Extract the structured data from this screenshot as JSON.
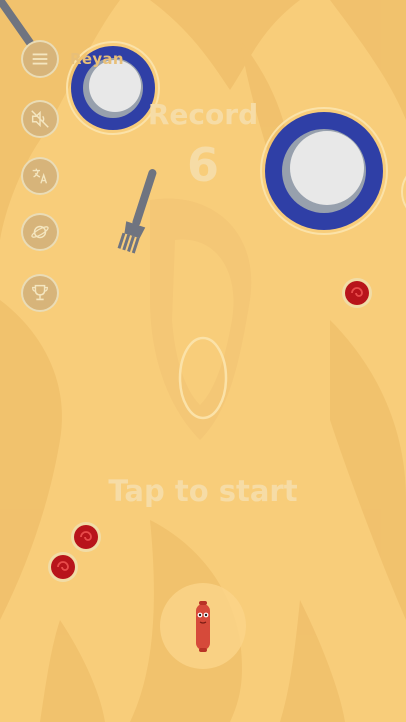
{
  "user": {
    "name": "Reyan"
  },
  "record": {
    "label": "Record",
    "value": "6"
  },
  "prompt": {
    "tap_to_start": "Tap to start"
  },
  "side_buttons": [
    {
      "id": "menu",
      "icon": "hamburger-icon"
    },
    {
      "id": "sound",
      "icon": "sound-muted-icon"
    },
    {
      "id": "language",
      "icon": "translate-icon"
    },
    {
      "id": "worlds",
      "icon": "planet-icon"
    },
    {
      "id": "leaderboard",
      "icon": "trophy-icon"
    }
  ],
  "colors": {
    "background": "#f8cd7a",
    "wood_grain": "#f0be68",
    "plate_rim": "#2f3fa6",
    "plate_center": "#e6e6e6",
    "ketchup": "#b8141b",
    "sausage": "#d64a3a",
    "ui_text": "#f6dca6"
  }
}
